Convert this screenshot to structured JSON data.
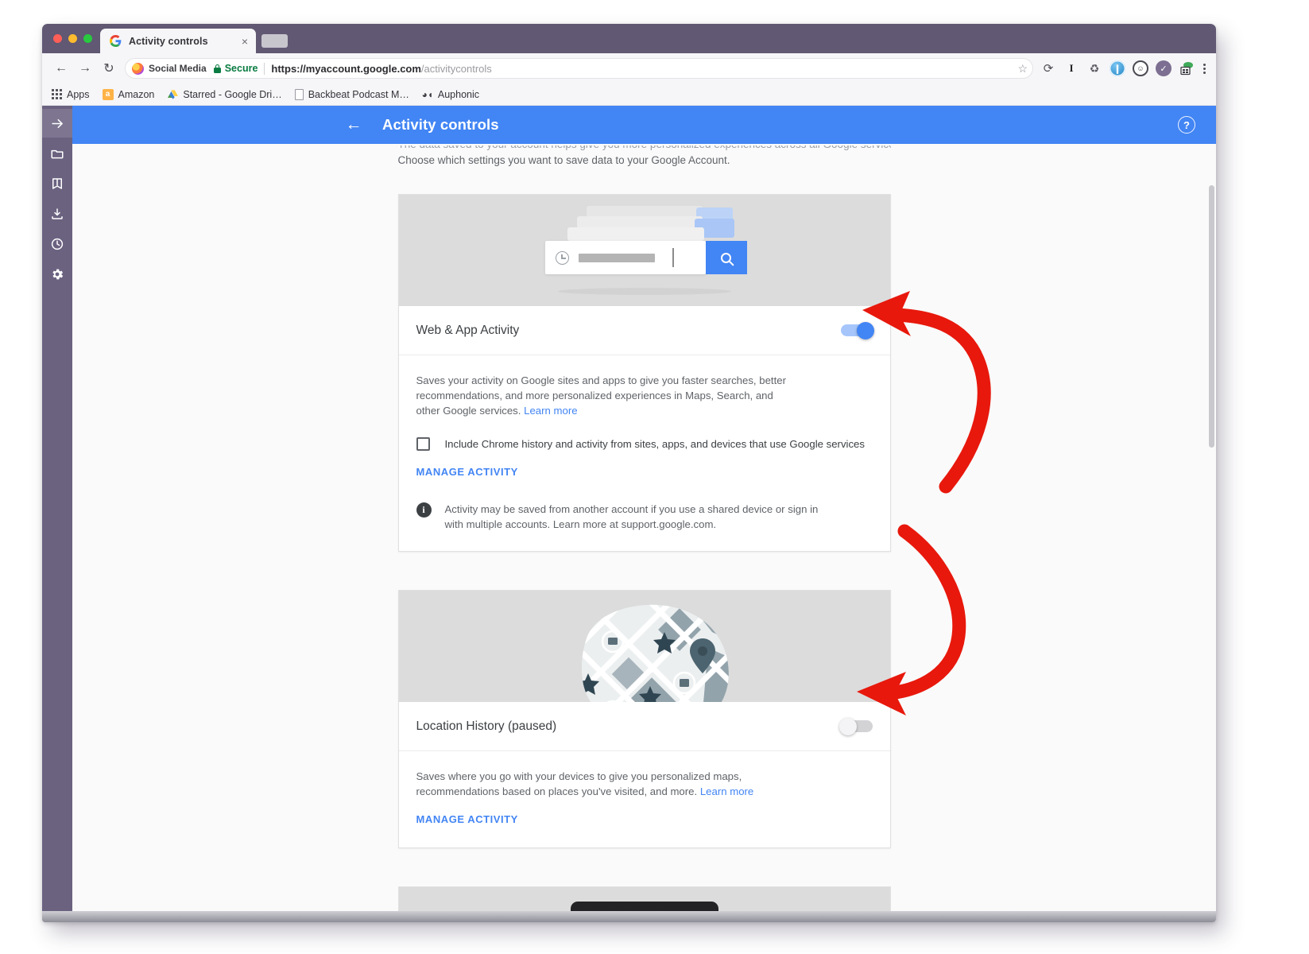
{
  "browser": {
    "tab": {
      "title": "Activity controls",
      "favicon": "google-g-icon",
      "close": "×"
    },
    "toolbar": {
      "back": "←",
      "forward": "→",
      "reload": "↻",
      "profile_name": "Social Media",
      "secure_label": "Secure",
      "url_host": "https://myaccount.google.com",
      "url_path": "/activitycontrols",
      "star": "☆",
      "extensions": [
        "search-extension-icon",
        "italic-i-extension-icon",
        "recycle-extension-icon",
        "shield-extension-icon",
        "face-extension-icon",
        "checkmark-extension-icon",
        "calendar-extension-icon"
      ],
      "menu": "kebab-menu-icon"
    },
    "bookmarks": [
      {
        "label": "Apps",
        "icon": "apps-grid-icon"
      },
      {
        "label": "Amazon",
        "icon": "amazon-icon"
      },
      {
        "label": "Starred - Google Dri…",
        "icon": "google-drive-icon"
      },
      {
        "label": "Backbeat Podcast M…",
        "icon": "document-icon"
      },
      {
        "label": "Auphonic",
        "icon": "auphonic-icon"
      }
    ]
  },
  "sidebar": {
    "items": [
      {
        "name": "expand",
        "glyph": "→"
      },
      {
        "name": "folder",
        "glyph": "🗀"
      },
      {
        "name": "bookmarks",
        "glyph": "🔖"
      },
      {
        "name": "downloads",
        "glyph": "⤓"
      },
      {
        "name": "history",
        "glyph": "◷"
      },
      {
        "name": "settings",
        "glyph": "⚙"
      }
    ]
  },
  "app": {
    "title": "Activity controls",
    "back_arrow": "←",
    "help": "?",
    "accent_color": "#4285f4"
  },
  "intro": {
    "line1": "The data saved to your account helps give you more personalized experiences across all Google services.",
    "line2": "Choose which settings you want to save data to your Google Account."
  },
  "cards": [
    {
      "title": "Web & App Activity",
      "toggle_state": "on",
      "description": "Saves your activity on Google sites and apps to give you faster searches, better recommendations, and more personalized experiences in Maps, Search, and other Google services.",
      "learn_more": "Learn more",
      "checkbox_label": "Include Chrome history and activity from sites, apps, and devices that use Google services",
      "checkbox_checked": false,
      "action": "MANAGE ACTIVITY",
      "note": "Activity may be saved from another account if you use a shared device or sign in with multiple accounts. Learn more at support.google.com.",
      "hero": "search-illustration"
    },
    {
      "title": "Location History (paused)",
      "toggle_state": "off",
      "description": "Saves where you go with your devices to give you personalized maps, recommendations based on places you've visited, and more.",
      "learn_more": "Learn more",
      "action": "MANAGE ACTIVITY",
      "hero": "map-illustration"
    }
  ],
  "annotations": {
    "color": "#e8180c",
    "arrows": [
      {
        "name": "arrow-to-web-app-toggle",
        "points_to": "Web & App Activity toggle"
      },
      {
        "name": "arrow-to-location-history-toggle",
        "points_to": "Location History toggle"
      }
    ]
  }
}
